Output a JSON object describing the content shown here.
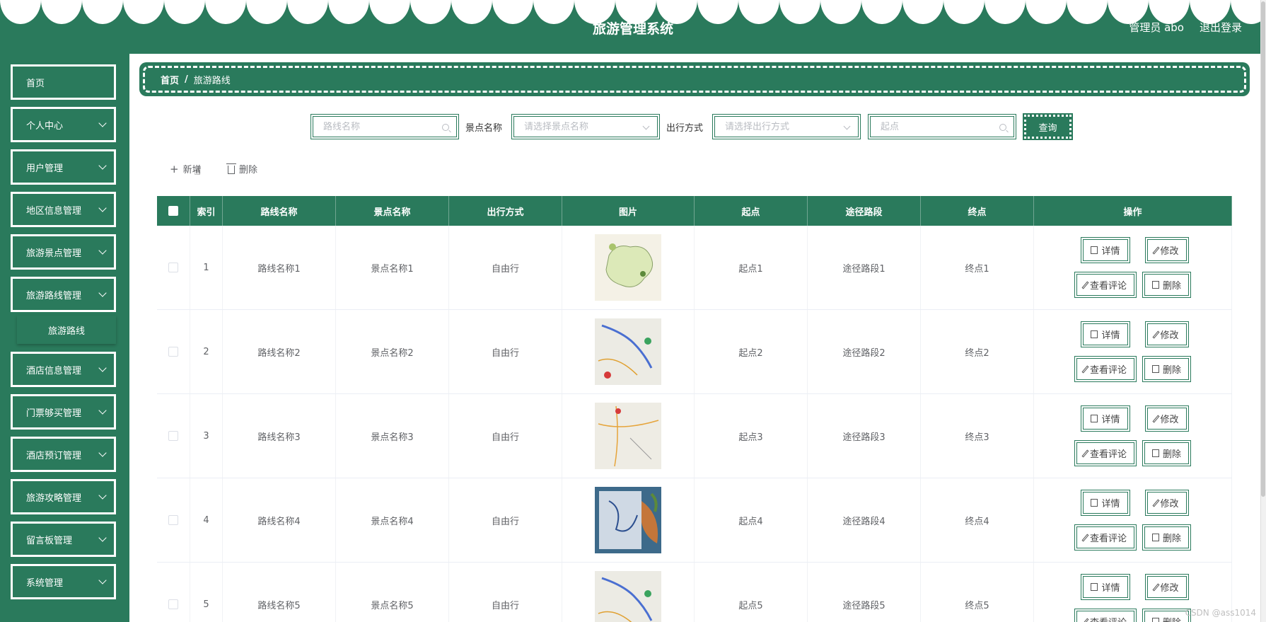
{
  "header": {
    "title": "旅游管理系统",
    "user": "管理员 abo",
    "logout": "退出登录"
  },
  "sidebar": {
    "items": [
      {
        "label": "首页",
        "has_arrow": false
      },
      {
        "label": "个人中心",
        "has_arrow": true
      },
      {
        "label": "用户管理",
        "has_arrow": true
      },
      {
        "label": "地区信息管理",
        "has_arrow": true
      },
      {
        "label": "旅游景点管理",
        "has_arrow": true
      },
      {
        "label": "旅游路线管理",
        "has_arrow": true
      },
      {
        "label": "酒店信息管理",
        "has_arrow": true
      },
      {
        "label": "门票够买管理",
        "has_arrow": true
      },
      {
        "label": "酒店预订管理",
        "has_arrow": true
      },
      {
        "label": "旅游攻略管理",
        "has_arrow": true
      },
      {
        "label": "留言板管理",
        "has_arrow": true
      },
      {
        "label": "系统管理",
        "has_arrow": true
      }
    ],
    "submenu_label": "旅游路线"
  },
  "breadcrumb": {
    "home": "首页",
    "separator": "/",
    "current": "旅游路线"
  },
  "search": {
    "route_name_placeholder": "路线名称",
    "scenic_label": "景点名称",
    "scenic_placeholder": "请选择景点名称",
    "travel_label": "出行方式",
    "travel_placeholder": "请选择出行方式",
    "start_placeholder": "起点",
    "query_button": "查询"
  },
  "actions": {
    "add": "新增",
    "delete": "删除"
  },
  "table": {
    "headers": [
      "索引",
      "路线名称",
      "景点名称",
      "出行方式",
      "图片",
      "起点",
      "途径路段",
      "终点",
      "操作"
    ],
    "rows": [
      {
        "index": "1",
        "route": "路线名称1",
        "scenic": "景点名称1",
        "travel": "自由行",
        "start": "起点1",
        "via": "途径路段1",
        "end": "终点1"
      },
      {
        "index": "2",
        "route": "路线名称2",
        "scenic": "景点名称2",
        "travel": "自由行",
        "start": "起点2",
        "via": "途径路段2",
        "end": "终点2"
      },
      {
        "index": "3",
        "route": "路线名称3",
        "scenic": "景点名称3",
        "travel": "自由行",
        "start": "起点3",
        "via": "途径路段3",
        "end": "终点3"
      },
      {
        "index": "4",
        "route": "路线名称4",
        "scenic": "景点名称4",
        "travel": "自由行",
        "start": "起点4",
        "via": "途径路段4",
        "end": "终点4"
      },
      {
        "index": "5",
        "route": "路线名称5",
        "scenic": "景点名称5",
        "travel": "自由行",
        "start": "起点5",
        "via": "途径路段5",
        "end": "终点5"
      }
    ],
    "ops": {
      "detail": "详情",
      "edit": "修改",
      "comments": "查看评论",
      "delete": "删除"
    }
  },
  "watermark": "CSDN @ass1014",
  "colors": {
    "primary": "#2a7a5c"
  },
  "icons": [
    "search-icon",
    "chevron-down-icon",
    "plus-icon",
    "trash-icon",
    "document-icon",
    "pencil-icon",
    "hand-cursor-icon"
  ]
}
